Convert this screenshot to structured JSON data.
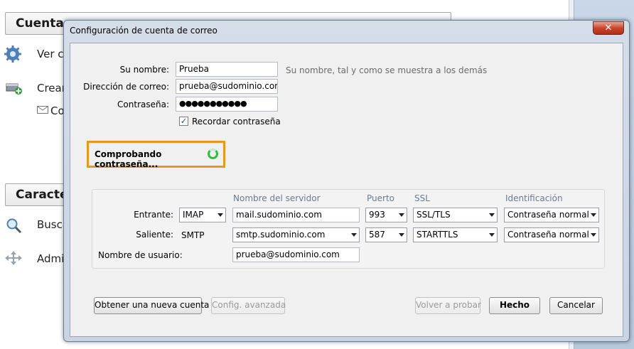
{
  "background": {
    "section1": "Cuentas",
    "item_view": "Ver co",
    "item_create": "Crear",
    "item_mail": "Co",
    "section2": "Caracter",
    "item_search": "Busca",
    "item_admin": "Admi",
    "icons": [
      "gear-icon",
      "add-account-icon",
      "envelope-icon",
      "magnifier-icon",
      "arrows-icon"
    ]
  },
  "dialog": {
    "title": "Configuración de cuenta de correo",
    "close_label": "✕",
    "name_label": "Su nombre:",
    "name_value": "Prueba",
    "name_hint": "Su nombre, tal y como se muestra a los demás",
    "email_label": "Dirección de correo:",
    "email_value": "prueba@sudominio.com",
    "password_label": "Contraseña:",
    "password_value": "●●●●●●●●●●●",
    "remember_label": "Recordar contraseña",
    "remember_checked": "✓",
    "status_text": "Comprobando contraseña...",
    "status_color": "#e8961e",
    "server": {
      "col_server": "Nombre del servidor",
      "col_port": "Puerto",
      "col_ssl": "SSL",
      "col_auth": "Identificación",
      "incoming_label": "Entrante:",
      "incoming_protocol": "IMAP",
      "incoming_server": "mail.sudominio.com",
      "incoming_port": "993",
      "incoming_ssl": "SSL/TLS",
      "incoming_auth": "Contraseña normal",
      "outgoing_label": "Saliente:",
      "outgoing_protocol": "SMTP",
      "outgoing_server": "smtp.sudominio.com",
      "outgoing_port": "587",
      "outgoing_ssl": "STARTTLS",
      "outgoing_auth": "Contraseña normal",
      "username_label": "Nombre de usuario:",
      "username_value": "prueba@sudominio.com"
    },
    "buttons": {
      "new_account": "Obtener una nueva cuenta",
      "advanced": "Config. avanzada",
      "retest": "Volver a probar",
      "done": "Hecho",
      "cancel": "Cancelar"
    }
  }
}
